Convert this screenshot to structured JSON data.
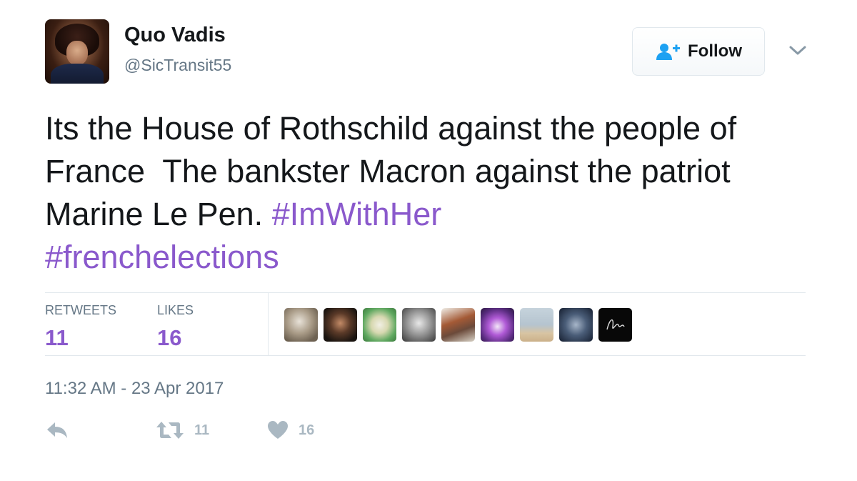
{
  "author": {
    "display_name": "Quo Vadis",
    "handle": "@SicTransit55"
  },
  "follow_button": {
    "label": "Follow"
  },
  "tweet": {
    "text_plain": "Its the House of Rothschild against the people of France  The bankster Macron against the patriot Marine Le Pen. ",
    "hashtags": [
      "#ImWithHer",
      "#frenchelections"
    ],
    "timestamp": "11:32 AM - 23 Apr 2017"
  },
  "stats": {
    "retweets_label": "RETWEETS",
    "retweets_count": "11",
    "likes_label": "LIKES",
    "likes_count": "16"
  },
  "actions": {
    "reply_icon": "reply-icon",
    "retweet_icon": "retweet-icon",
    "retweet_count": "11",
    "like_icon": "heart-icon",
    "like_count": "16"
  },
  "colors": {
    "hashtag": "#8a59cc",
    "count_accent": "#8a59cc",
    "muted_text": "#657786",
    "action_icon": "#aab8c2",
    "follow_icon": "#1da1f2"
  }
}
